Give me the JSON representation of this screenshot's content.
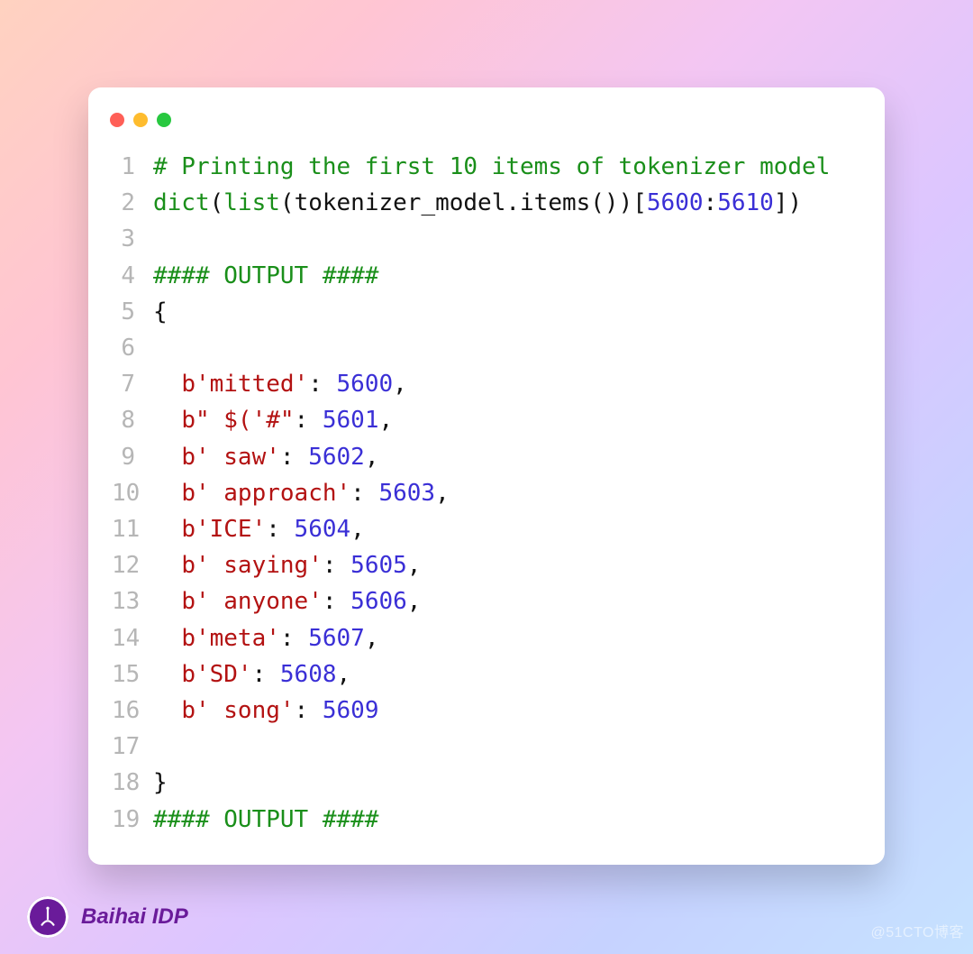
{
  "brand": {
    "name": "Baihai IDP"
  },
  "watermark": "@51CTO博客",
  "code": {
    "line_numbers": [
      "1",
      "2",
      "3",
      "4",
      "5",
      "6",
      "7",
      "8",
      "9",
      "10",
      "11",
      "12",
      "13",
      "14",
      "15",
      "16",
      "17",
      "18",
      "19"
    ],
    "lines": [
      [
        {
          "cls": "tok-comment",
          "t": "# Printing the first 10 items of tokenizer model"
        }
      ],
      [
        {
          "cls": "tok-builtin",
          "t": "dict"
        },
        {
          "cls": "tok-punct",
          "t": "("
        },
        {
          "cls": "tok-builtin",
          "t": "list"
        },
        {
          "cls": "tok-punct",
          "t": "("
        },
        {
          "cls": "tok-ident",
          "t": "tokenizer_model.items()"
        },
        {
          "cls": "tok-punct",
          "t": ")["
        },
        {
          "cls": "tok-num",
          "t": "5600"
        },
        {
          "cls": "tok-punct",
          "t": ":"
        },
        {
          "cls": "tok-num",
          "t": "5610"
        },
        {
          "cls": "tok-punct",
          "t": "])"
        }
      ],
      [
        {
          "cls": "tok-ident",
          "t": ""
        }
      ],
      [
        {
          "cls": "tok-comment",
          "t": "#### OUTPUT ####"
        }
      ],
      [
        {
          "cls": "tok-punct",
          "t": "{"
        }
      ],
      [
        {
          "cls": "tok-ident",
          "t": ""
        }
      ],
      [
        {
          "cls": "tok-ident",
          "t": "  "
        },
        {
          "cls": "tok-bytes",
          "t": "b'mitted'"
        },
        {
          "cls": "tok-punct",
          "t": ": "
        },
        {
          "cls": "tok-num",
          "t": "5600"
        },
        {
          "cls": "tok-punct",
          "t": ","
        }
      ],
      [
        {
          "cls": "tok-ident",
          "t": "  "
        },
        {
          "cls": "tok-bytes",
          "t": "b\" $('#\""
        },
        {
          "cls": "tok-punct",
          "t": ": "
        },
        {
          "cls": "tok-num",
          "t": "5601"
        },
        {
          "cls": "tok-punct",
          "t": ","
        }
      ],
      [
        {
          "cls": "tok-ident",
          "t": "  "
        },
        {
          "cls": "tok-bytes",
          "t": "b' saw'"
        },
        {
          "cls": "tok-punct",
          "t": ": "
        },
        {
          "cls": "tok-num",
          "t": "5602"
        },
        {
          "cls": "tok-punct",
          "t": ","
        }
      ],
      [
        {
          "cls": "tok-ident",
          "t": "  "
        },
        {
          "cls": "tok-bytes",
          "t": "b' approach'"
        },
        {
          "cls": "tok-punct",
          "t": ": "
        },
        {
          "cls": "tok-num",
          "t": "5603"
        },
        {
          "cls": "tok-punct",
          "t": ","
        }
      ],
      [
        {
          "cls": "tok-ident",
          "t": "  "
        },
        {
          "cls": "tok-bytes",
          "t": "b'ICE'"
        },
        {
          "cls": "tok-punct",
          "t": ": "
        },
        {
          "cls": "tok-num",
          "t": "5604"
        },
        {
          "cls": "tok-punct",
          "t": ","
        }
      ],
      [
        {
          "cls": "tok-ident",
          "t": "  "
        },
        {
          "cls": "tok-bytes",
          "t": "b' saying'"
        },
        {
          "cls": "tok-punct",
          "t": ": "
        },
        {
          "cls": "tok-num",
          "t": "5605"
        },
        {
          "cls": "tok-punct",
          "t": ","
        }
      ],
      [
        {
          "cls": "tok-ident",
          "t": "  "
        },
        {
          "cls": "tok-bytes",
          "t": "b' anyone'"
        },
        {
          "cls": "tok-punct",
          "t": ": "
        },
        {
          "cls": "tok-num",
          "t": "5606"
        },
        {
          "cls": "tok-punct",
          "t": ","
        }
      ],
      [
        {
          "cls": "tok-ident",
          "t": "  "
        },
        {
          "cls": "tok-bytes",
          "t": "b'meta'"
        },
        {
          "cls": "tok-punct",
          "t": ": "
        },
        {
          "cls": "tok-num",
          "t": "5607"
        },
        {
          "cls": "tok-punct",
          "t": ","
        }
      ],
      [
        {
          "cls": "tok-ident",
          "t": "  "
        },
        {
          "cls": "tok-bytes",
          "t": "b'SD'"
        },
        {
          "cls": "tok-punct",
          "t": ": "
        },
        {
          "cls": "tok-num",
          "t": "5608"
        },
        {
          "cls": "tok-punct",
          "t": ","
        }
      ],
      [
        {
          "cls": "tok-ident",
          "t": "  "
        },
        {
          "cls": "tok-bytes",
          "t": "b' song'"
        },
        {
          "cls": "tok-punct",
          "t": ": "
        },
        {
          "cls": "tok-num",
          "t": "5609"
        }
      ],
      [
        {
          "cls": "tok-ident",
          "t": ""
        }
      ],
      [
        {
          "cls": "tok-punct",
          "t": "}"
        }
      ],
      [
        {
          "cls": "tok-comment",
          "t": "#### OUTPUT ####"
        }
      ]
    ]
  }
}
